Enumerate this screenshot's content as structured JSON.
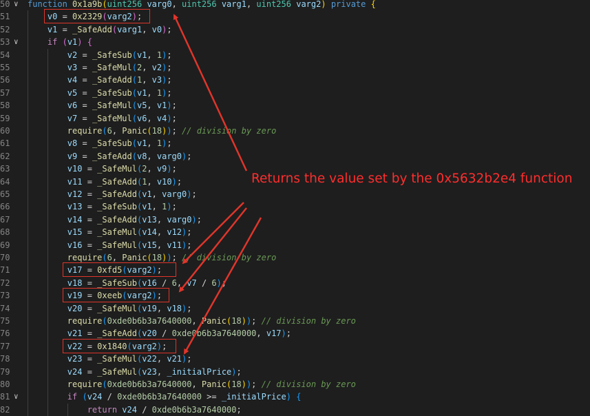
{
  "annotation": "Returns the value set by the 0x5632b2e4 function",
  "colors": {
    "annotation": "#ff2d2d",
    "box": "#e0352b"
  },
  "lines": [
    {
      "n": "50",
      "fold": "down",
      "indent": 0,
      "tokens": [
        [
          "kw",
          "function"
        ],
        [
          "p",
          " "
        ],
        [
          "fn",
          "0x1a9b"
        ],
        [
          "br1",
          "("
        ],
        [
          "ty",
          "uint256"
        ],
        [
          "p",
          " "
        ],
        [
          "var",
          "varg0"
        ],
        [
          "p",
          ", "
        ],
        [
          "ty",
          "uint256"
        ],
        [
          "p",
          " "
        ],
        [
          "var",
          "varg1"
        ],
        [
          "p",
          ", "
        ],
        [
          "ty",
          "uint256"
        ],
        [
          "p",
          " "
        ],
        [
          "var",
          "varg2"
        ],
        [
          "br1",
          ")"
        ],
        [
          "p",
          " "
        ],
        [
          "kw",
          "private"
        ],
        [
          "p",
          " "
        ],
        [
          "br1",
          "{"
        ]
      ]
    },
    {
      "n": "51",
      "indent": 1,
      "tokens": [
        [
          "var",
          "v0"
        ],
        [
          "p",
          " = "
        ],
        [
          "fn",
          "0x2329"
        ],
        [
          "br2",
          "("
        ],
        [
          "var",
          "varg2"
        ],
        [
          "br2",
          ")"
        ],
        [
          "p",
          ";"
        ]
      ]
    },
    {
      "n": "52",
      "indent": 1,
      "tokens": [
        [
          "var",
          "v1"
        ],
        [
          "p",
          " = "
        ],
        [
          "fn",
          "_SafeAdd"
        ],
        [
          "br2",
          "("
        ],
        [
          "var",
          "varg1"
        ],
        [
          "p",
          ", "
        ],
        [
          "var",
          "v0"
        ],
        [
          "br2",
          ")"
        ],
        [
          "p",
          ";"
        ]
      ]
    },
    {
      "n": "53",
      "fold": "down",
      "indent": 1,
      "tokens": [
        [
          "ctl",
          "if"
        ],
        [
          "p",
          " "
        ],
        [
          "br2",
          "("
        ],
        [
          "var",
          "v1"
        ],
        [
          "br2",
          ")"
        ],
        [
          "p",
          " "
        ],
        [
          "br2",
          "{"
        ]
      ]
    },
    {
      "n": "54",
      "indent": 2,
      "tokens": [
        [
          "var",
          "v2"
        ],
        [
          "p",
          " = "
        ],
        [
          "fn",
          "_SafeSub"
        ],
        [
          "br3",
          "("
        ],
        [
          "var",
          "v1"
        ],
        [
          "p",
          ", "
        ],
        [
          "num",
          "1"
        ],
        [
          "br3",
          ")"
        ],
        [
          "p",
          ";"
        ]
      ]
    },
    {
      "n": "55",
      "indent": 2,
      "tokens": [
        [
          "var",
          "v3"
        ],
        [
          "p",
          " = "
        ],
        [
          "fn",
          "_SafeMul"
        ],
        [
          "br3",
          "("
        ],
        [
          "num",
          "2"
        ],
        [
          "p",
          ", "
        ],
        [
          "var",
          "v2"
        ],
        [
          "br3",
          ")"
        ],
        [
          "p",
          ";"
        ]
      ]
    },
    {
      "n": "56",
      "indent": 2,
      "tokens": [
        [
          "var",
          "v4"
        ],
        [
          "p",
          " = "
        ],
        [
          "fn",
          "_SafeAdd"
        ],
        [
          "br3",
          "("
        ],
        [
          "num",
          "1"
        ],
        [
          "p",
          ", "
        ],
        [
          "var",
          "v3"
        ],
        [
          "br3",
          ")"
        ],
        [
          "p",
          ";"
        ]
      ]
    },
    {
      "n": "57",
      "indent": 2,
      "tokens": [
        [
          "var",
          "v5"
        ],
        [
          "p",
          " = "
        ],
        [
          "fn",
          "_SafeSub"
        ],
        [
          "br3",
          "("
        ],
        [
          "var",
          "v1"
        ],
        [
          "p",
          ", "
        ],
        [
          "num",
          "1"
        ],
        [
          "br3",
          ")"
        ],
        [
          "p",
          ";"
        ]
      ]
    },
    {
      "n": "58",
      "indent": 2,
      "tokens": [
        [
          "var",
          "v6"
        ],
        [
          "p",
          " = "
        ],
        [
          "fn",
          "_SafeMul"
        ],
        [
          "br3",
          "("
        ],
        [
          "var",
          "v5"
        ],
        [
          "p",
          ", "
        ],
        [
          "var",
          "v1"
        ],
        [
          "br3",
          ")"
        ],
        [
          "p",
          ";"
        ]
      ]
    },
    {
      "n": "59",
      "indent": 2,
      "tokens": [
        [
          "var",
          "v7"
        ],
        [
          "p",
          " = "
        ],
        [
          "fn",
          "_SafeMul"
        ],
        [
          "br3",
          "("
        ],
        [
          "var",
          "v6"
        ],
        [
          "p",
          ", "
        ],
        [
          "var",
          "v4"
        ],
        [
          "br3",
          ")"
        ],
        [
          "p",
          ";"
        ]
      ]
    },
    {
      "n": "60",
      "indent": 2,
      "tokens": [
        [
          "fn",
          "require"
        ],
        [
          "br3",
          "("
        ],
        [
          "num",
          "6"
        ],
        [
          "p",
          ", "
        ],
        [
          "fn",
          "Panic"
        ],
        [
          "br1",
          "("
        ],
        [
          "num",
          "18"
        ],
        [
          "br1",
          ")"
        ],
        [
          "br3",
          ")"
        ],
        [
          "p",
          "; "
        ],
        [
          "cm",
          "// division by zero"
        ]
      ]
    },
    {
      "n": "61",
      "indent": 2,
      "tokens": [
        [
          "var",
          "v8"
        ],
        [
          "p",
          " = "
        ],
        [
          "fn",
          "_SafeSub"
        ],
        [
          "br3",
          "("
        ],
        [
          "var",
          "v1"
        ],
        [
          "p",
          ", "
        ],
        [
          "num",
          "1"
        ],
        [
          "br3",
          ")"
        ],
        [
          "p",
          ";"
        ]
      ]
    },
    {
      "n": "62",
      "indent": 2,
      "tokens": [
        [
          "var",
          "v9"
        ],
        [
          "p",
          " = "
        ],
        [
          "fn",
          "_SafeAdd"
        ],
        [
          "br3",
          "("
        ],
        [
          "var",
          "v8"
        ],
        [
          "p",
          ", "
        ],
        [
          "var",
          "varg0"
        ],
        [
          "br3",
          ")"
        ],
        [
          "p",
          ";"
        ]
      ]
    },
    {
      "n": "63",
      "indent": 2,
      "tokens": [
        [
          "var",
          "v10"
        ],
        [
          "p",
          " = "
        ],
        [
          "fn",
          "_SafeMul"
        ],
        [
          "br3",
          "("
        ],
        [
          "num",
          "2"
        ],
        [
          "p",
          ", "
        ],
        [
          "var",
          "v9"
        ],
        [
          "br3",
          ")"
        ],
        [
          "p",
          ";"
        ]
      ]
    },
    {
      "n": "64",
      "indent": 2,
      "tokens": [
        [
          "var",
          "v11"
        ],
        [
          "p",
          " = "
        ],
        [
          "fn",
          "_SafeAdd"
        ],
        [
          "br3",
          "("
        ],
        [
          "num",
          "1"
        ],
        [
          "p",
          ", "
        ],
        [
          "var",
          "v10"
        ],
        [
          "br3",
          ")"
        ],
        [
          "p",
          ";"
        ]
      ]
    },
    {
      "n": "65",
      "indent": 2,
      "tokens": [
        [
          "var",
          "v12"
        ],
        [
          "p",
          " = "
        ],
        [
          "fn",
          "_SafeAdd"
        ],
        [
          "br3",
          "("
        ],
        [
          "var",
          "v1"
        ],
        [
          "p",
          ", "
        ],
        [
          "var",
          "varg0"
        ],
        [
          "br3",
          ")"
        ],
        [
          "p",
          ";"
        ]
      ]
    },
    {
      "n": "66",
      "indent": 2,
      "tokens": [
        [
          "var",
          "v13"
        ],
        [
          "p",
          " = "
        ],
        [
          "fn",
          "_SafeSub"
        ],
        [
          "br3",
          "("
        ],
        [
          "var",
          "v1"
        ],
        [
          "p",
          ", "
        ],
        [
          "num",
          "1"
        ],
        [
          "br3",
          ")"
        ],
        [
          "p",
          ";"
        ]
      ]
    },
    {
      "n": "67",
      "indent": 2,
      "tokens": [
        [
          "var",
          "v14"
        ],
        [
          "p",
          " = "
        ],
        [
          "fn",
          "_SafeAdd"
        ],
        [
          "br3",
          "("
        ],
        [
          "var",
          "v13"
        ],
        [
          "p",
          ", "
        ],
        [
          "var",
          "varg0"
        ],
        [
          "br3",
          ")"
        ],
        [
          "p",
          ";"
        ]
      ]
    },
    {
      "n": "68",
      "indent": 2,
      "tokens": [
        [
          "var",
          "v15"
        ],
        [
          "p",
          " = "
        ],
        [
          "fn",
          "_SafeMul"
        ],
        [
          "br3",
          "("
        ],
        [
          "var",
          "v14"
        ],
        [
          "p",
          ", "
        ],
        [
          "var",
          "v12"
        ],
        [
          "br3",
          ")"
        ],
        [
          "p",
          ";"
        ]
      ]
    },
    {
      "n": "69",
      "indent": 2,
      "tokens": [
        [
          "var",
          "v16"
        ],
        [
          "p",
          " = "
        ],
        [
          "fn",
          "_SafeMul"
        ],
        [
          "br3",
          "("
        ],
        [
          "var",
          "v15"
        ],
        [
          "p",
          ", "
        ],
        [
          "var",
          "v11"
        ],
        [
          "br3",
          ")"
        ],
        [
          "p",
          ";"
        ]
      ]
    },
    {
      "n": "70",
      "indent": 2,
      "tokens": [
        [
          "fn",
          "require"
        ],
        [
          "br3",
          "("
        ],
        [
          "num",
          "6"
        ],
        [
          "p",
          ", "
        ],
        [
          "fn",
          "Panic"
        ],
        [
          "br1",
          "("
        ],
        [
          "num",
          "18"
        ],
        [
          "br1",
          ")"
        ],
        [
          "br3",
          ")"
        ],
        [
          "p",
          "; "
        ],
        [
          "cm",
          "// division by zero"
        ]
      ]
    },
    {
      "n": "71",
      "indent": 2,
      "tokens": [
        [
          "var",
          "v17"
        ],
        [
          "p",
          " = "
        ],
        [
          "fn",
          "0xfd5"
        ],
        [
          "br3",
          "("
        ],
        [
          "var",
          "varg2"
        ],
        [
          "br3",
          ")"
        ],
        [
          "p",
          ";"
        ]
      ]
    },
    {
      "n": "72",
      "indent": 2,
      "tokens": [
        [
          "var",
          "v18"
        ],
        [
          "p",
          " = "
        ],
        [
          "fn",
          "_SafeSub"
        ],
        [
          "br3",
          "("
        ],
        [
          "var",
          "v16"
        ],
        [
          "p",
          " / "
        ],
        [
          "num",
          "6"
        ],
        [
          "p",
          ", "
        ],
        [
          "var",
          "v7"
        ],
        [
          "p",
          " / "
        ],
        [
          "num",
          "6"
        ],
        [
          "br3",
          ")"
        ],
        [
          "p",
          ";"
        ]
      ]
    },
    {
      "n": "73",
      "indent": 2,
      "tokens": [
        [
          "var",
          "v19"
        ],
        [
          "p",
          " = "
        ],
        [
          "fn",
          "0xeeb"
        ],
        [
          "br3",
          "("
        ],
        [
          "var",
          "varg2"
        ],
        [
          "br3",
          ")"
        ],
        [
          "p",
          ";"
        ]
      ]
    },
    {
      "n": "74",
      "indent": 2,
      "tokens": [
        [
          "var",
          "v20"
        ],
        [
          "p",
          " = "
        ],
        [
          "fn",
          "_SafeMul"
        ],
        [
          "br3",
          "("
        ],
        [
          "var",
          "v19"
        ],
        [
          "p",
          ", "
        ],
        [
          "var",
          "v18"
        ],
        [
          "br3",
          ")"
        ],
        [
          "p",
          ";"
        ]
      ]
    },
    {
      "n": "75",
      "indent": 2,
      "tokens": [
        [
          "fn",
          "require"
        ],
        [
          "br3",
          "("
        ],
        [
          "num",
          "0xde0b6b3a7640000"
        ],
        [
          "p",
          ", "
        ],
        [
          "fn",
          "Panic"
        ],
        [
          "br1",
          "("
        ],
        [
          "num",
          "18"
        ],
        [
          "br1",
          ")"
        ],
        [
          "br3",
          ")"
        ],
        [
          "p",
          "; "
        ],
        [
          "cm",
          "// division by zero"
        ]
      ]
    },
    {
      "n": "76",
      "indent": 2,
      "tokens": [
        [
          "var",
          "v21"
        ],
        [
          "p",
          " = "
        ],
        [
          "fn",
          "_SafeAdd"
        ],
        [
          "br3",
          "("
        ],
        [
          "var",
          "v20"
        ],
        [
          "p",
          " / "
        ],
        [
          "num",
          "0xde0b6b3a7640000"
        ],
        [
          "p",
          ", "
        ],
        [
          "var",
          "v17"
        ],
        [
          "br3",
          ")"
        ],
        [
          "p",
          ";"
        ]
      ]
    },
    {
      "n": "77",
      "indent": 2,
      "tokens": [
        [
          "var",
          "v22"
        ],
        [
          "p",
          " = "
        ],
        [
          "fn",
          "0x1840"
        ],
        [
          "br3",
          "("
        ],
        [
          "var",
          "varg2"
        ],
        [
          "br3",
          ")"
        ],
        [
          "p",
          ";"
        ]
      ]
    },
    {
      "n": "78",
      "indent": 2,
      "tokens": [
        [
          "var",
          "v23"
        ],
        [
          "p",
          " = "
        ],
        [
          "fn",
          "_SafeMul"
        ],
        [
          "br3",
          "("
        ],
        [
          "var",
          "v22"
        ],
        [
          "p",
          ", "
        ],
        [
          "var",
          "v21"
        ],
        [
          "br3",
          ")"
        ],
        [
          "p",
          ";"
        ]
      ]
    },
    {
      "n": "79",
      "indent": 2,
      "tokens": [
        [
          "var",
          "v24"
        ],
        [
          "p",
          " = "
        ],
        [
          "fn",
          "_SafeMul"
        ],
        [
          "br3",
          "("
        ],
        [
          "var",
          "v23"
        ],
        [
          "p",
          ", "
        ],
        [
          "var",
          "_initialPrice"
        ],
        [
          "br3",
          ")"
        ],
        [
          "p",
          ";"
        ]
      ]
    },
    {
      "n": "80",
      "indent": 2,
      "tokens": [
        [
          "fn",
          "require"
        ],
        [
          "br3",
          "("
        ],
        [
          "num",
          "0xde0b6b3a7640000"
        ],
        [
          "p",
          ", "
        ],
        [
          "fn",
          "Panic"
        ],
        [
          "br1",
          "("
        ],
        [
          "num",
          "18"
        ],
        [
          "br1",
          ")"
        ],
        [
          "br3",
          ")"
        ],
        [
          "p",
          "; "
        ],
        [
          "cm",
          "// division by zero"
        ]
      ]
    },
    {
      "n": "81",
      "fold": "down",
      "indent": 2,
      "tokens": [
        [
          "ctl",
          "if"
        ],
        [
          "p",
          " "
        ],
        [
          "br3",
          "("
        ],
        [
          "var",
          "v24"
        ],
        [
          "p",
          " / "
        ],
        [
          "num",
          "0xde0b6b3a7640000"
        ],
        [
          "p",
          " >= "
        ],
        [
          "var",
          "_initialPrice"
        ],
        [
          "br3",
          ")"
        ],
        [
          "p",
          " "
        ],
        [
          "br3",
          "{"
        ]
      ]
    },
    {
      "n": "82",
      "indent": 3,
      "tokens": [
        [
          "ctl",
          "return"
        ],
        [
          "p",
          " "
        ],
        [
          "var",
          "v24"
        ],
        [
          "p",
          " / "
        ],
        [
          "num",
          "0xde0b6b3a7640000"
        ],
        [
          "p",
          ";"
        ]
      ]
    }
  ]
}
